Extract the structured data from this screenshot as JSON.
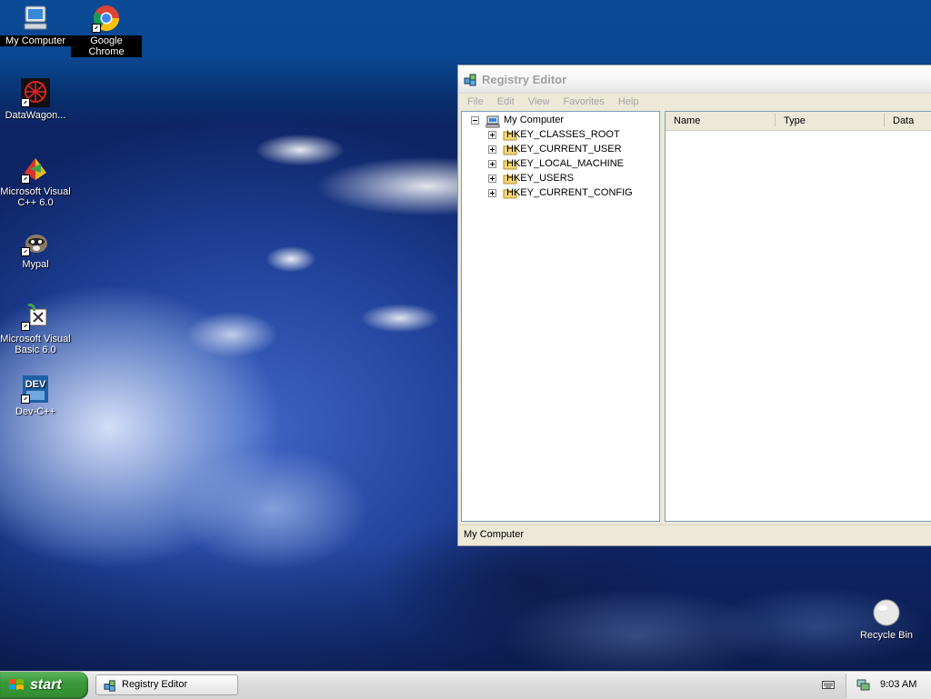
{
  "desktop": {
    "icons": [
      {
        "label": "My Computer",
        "icon": "my-computer-icon"
      },
      {
        "label": "Google Chrome",
        "icon": "chrome-icon"
      },
      {
        "label": "DataWagon...",
        "icon": "datawagon-icon"
      },
      {
        "label": "Microsoft Visual C++ 6.0",
        "icon": "visual-cpp-icon"
      },
      {
        "label": "Mypal",
        "icon": "mypal-icon"
      },
      {
        "label": "Microsoft Visual Basic 6.0",
        "icon": "visual-basic-icon"
      },
      {
        "label": "Dev-C++",
        "icon": "dev-cpp-icon"
      },
      {
        "label": "Recycle Bin",
        "icon": "recycle-bin-icon"
      }
    ]
  },
  "window": {
    "title": "Registry Editor",
    "menu": [
      "File",
      "Edit",
      "View",
      "Favorites",
      "Help"
    ],
    "tree": {
      "root": "My Computer",
      "keys": [
        "HKEY_CLASSES_ROOT",
        "HKEY_CURRENT_USER",
        "HKEY_LOCAL_MACHINE",
        "HKEY_USERS",
        "HKEY_CURRENT_CONFIG"
      ]
    },
    "columns": [
      "Name",
      "Type",
      "Data"
    ],
    "status": "My Computer"
  },
  "taskbar": {
    "start_label": "start",
    "tasks": [
      "Registry Editor"
    ],
    "clock": "9:03 AM"
  },
  "colors": {
    "desktop_blue": "#0a4792",
    "start_green": "#3a9a3a",
    "folder_yellow": "#f3d777"
  }
}
